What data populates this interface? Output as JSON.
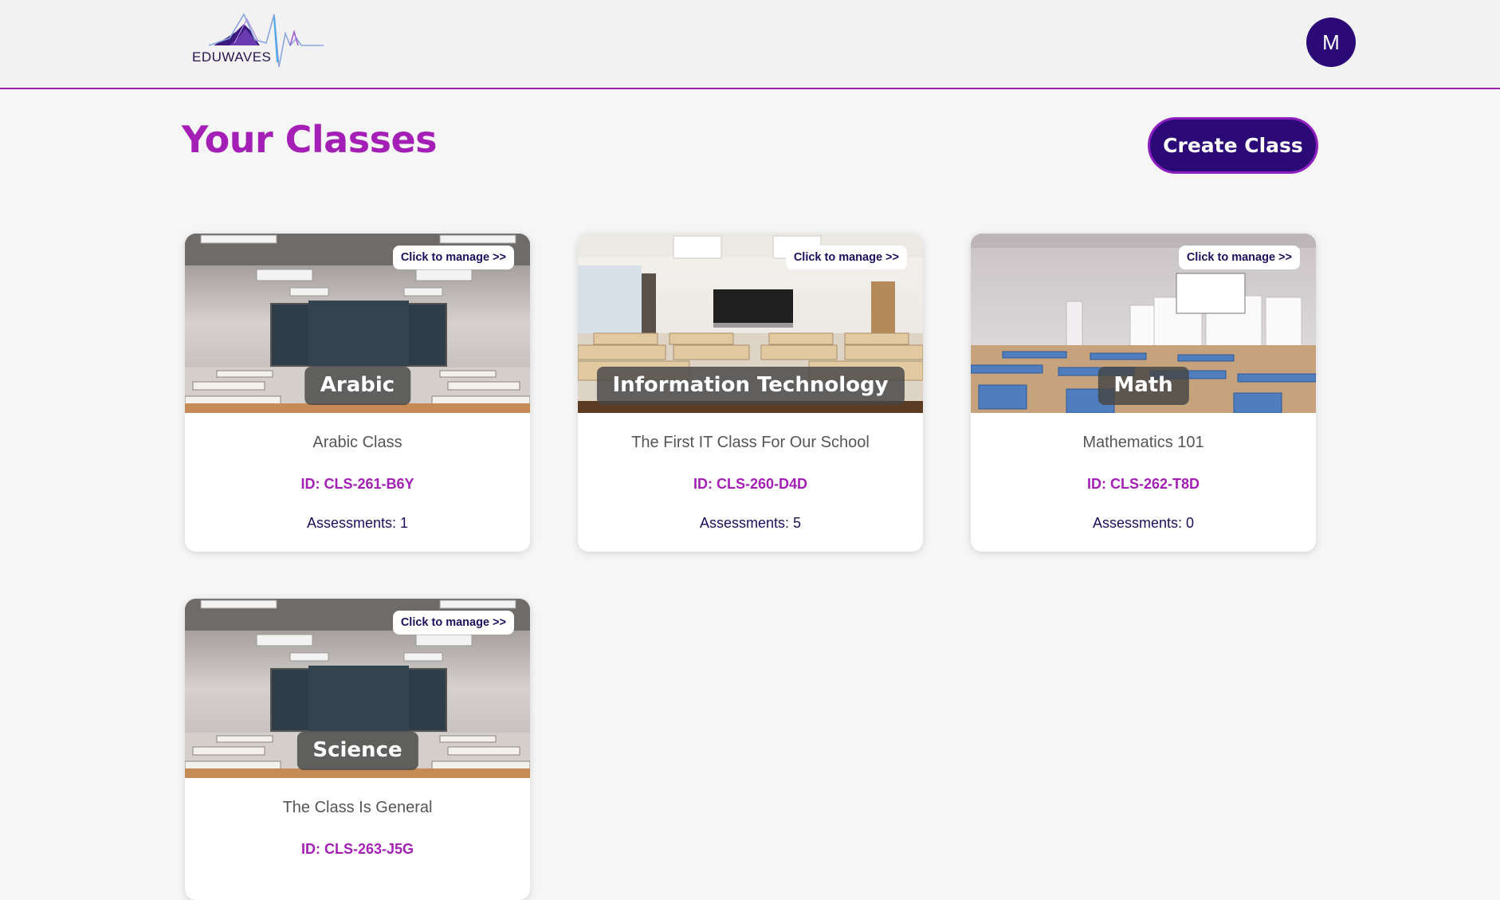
{
  "header": {
    "logo_text": "EDUWAVES",
    "avatar_initial": "M"
  },
  "main": {
    "title": "Your Classes",
    "create_button": "Create Class"
  },
  "colors": {
    "brand_purple": "#a31fb5",
    "brand_navy": "#2b0a78"
  },
  "classes": [
    {
      "subject": "Arabic",
      "manage_label": "Click to manage >>",
      "description": "Arabic Class",
      "id_label": "ID: CLS-261-B6Y",
      "assessments_label": "Assessments: 1"
    },
    {
      "subject": "Information Technology",
      "manage_label": "Click to manage >>",
      "description": "The First IT Class For Our School",
      "id_label": "ID: CLS-260-D4D",
      "assessments_label": "Assessments: 5"
    },
    {
      "subject": "Math",
      "manage_label": "Click to manage >>",
      "description": "Mathematics 101",
      "id_label": "ID: CLS-262-T8D",
      "assessments_label": "Assessments: 0"
    },
    {
      "subject": "Science",
      "manage_label": "Click to manage >>",
      "description": "The Class Is General",
      "id_label": "ID: CLS-263-J5G",
      "assessments_label": ""
    }
  ]
}
